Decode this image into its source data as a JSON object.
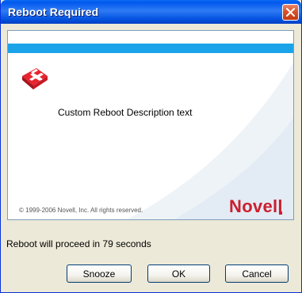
{
  "window": {
    "title": "Reboot Required"
  },
  "panel": {
    "description": "Custom Reboot Description text",
    "copyright": "© 1999-2006 Novell, Inc. All rights reserved.",
    "logo": "Novell"
  },
  "status": {
    "text": "Reboot will proceed in 79 seconds"
  },
  "buttons": {
    "snooze": "Snooze",
    "ok": "OK",
    "cancel": "Cancel"
  },
  "colors": {
    "titlebar": "#0058ee",
    "accent_bar": "#1aa3e8",
    "logo": "#cc1f2e",
    "close": "#d8522a"
  },
  "icons": {
    "close": "close-icon",
    "app": "first-aid-kit-icon"
  }
}
